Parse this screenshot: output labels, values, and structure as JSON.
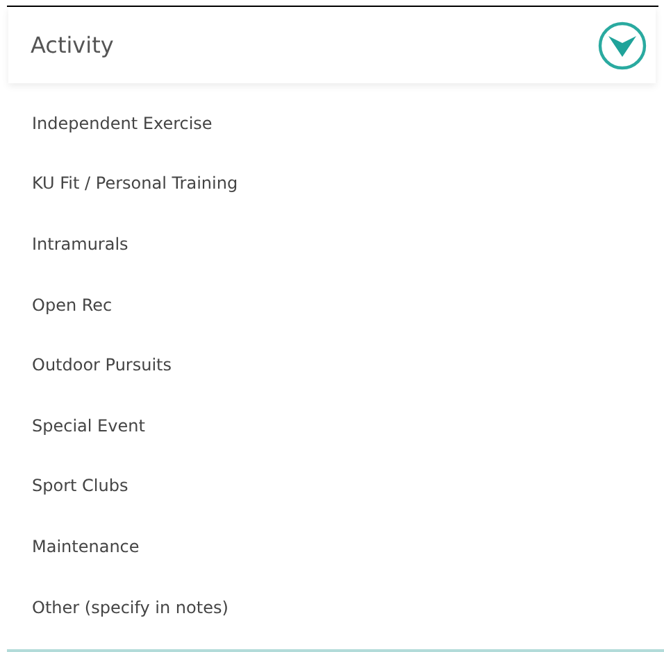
{
  "dropdown": {
    "label": "Activity"
  },
  "options": [
    "Independent Exercise",
    "KU Fit / Personal Training",
    "Intramurals",
    "Open Rec",
    "Outdoor Pursuits",
    "Special Event",
    "Sport Clubs",
    "Maintenance",
    "Other (specify in notes)"
  ]
}
